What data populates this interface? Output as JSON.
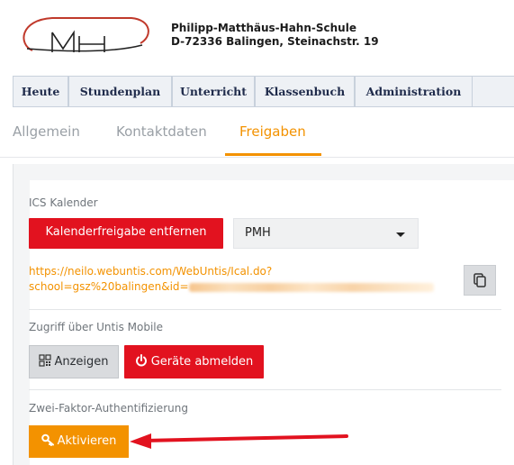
{
  "school": {
    "name": "Philipp-Matthäus-Hahn-Schule",
    "address": "D-72336 Balingen, Steinachstr. 19",
    "logo_text": "MH"
  },
  "topnav": [
    "Heute",
    "Stundenplan",
    "Unterricht",
    "Klassenbuch",
    "Administration"
  ],
  "tabs": {
    "allgemein": "Allgemein",
    "kontaktdaten": "Kontaktdaten",
    "freigaben": "Freigaben"
  },
  "ics": {
    "title": "ICS Kalender",
    "remove_button": "Kalenderfreigabe entfernen",
    "select_value": "PMH",
    "link_line1": "https://neilo.webuntis.com/WebUntis/Ical.do?",
    "link_line2": "school=gsz%20balingen&id="
  },
  "mobile": {
    "title": "Zugriff über Untis Mobile",
    "show_button": "Anzeigen",
    "logout_button": "Geräte abmelden"
  },
  "twofa": {
    "title": "Zwei-Faktor-Authentifizierung",
    "activate_button": "Aktivieren"
  },
  "colors": {
    "accent": "#f39200",
    "danger": "#e2121f",
    "arrow": "#e2121f"
  },
  "icons": {
    "copy": "copy-icon",
    "qr": "qr-code-icon",
    "power": "power-icon",
    "key": "key-icon",
    "caret": "caret-down-icon"
  }
}
